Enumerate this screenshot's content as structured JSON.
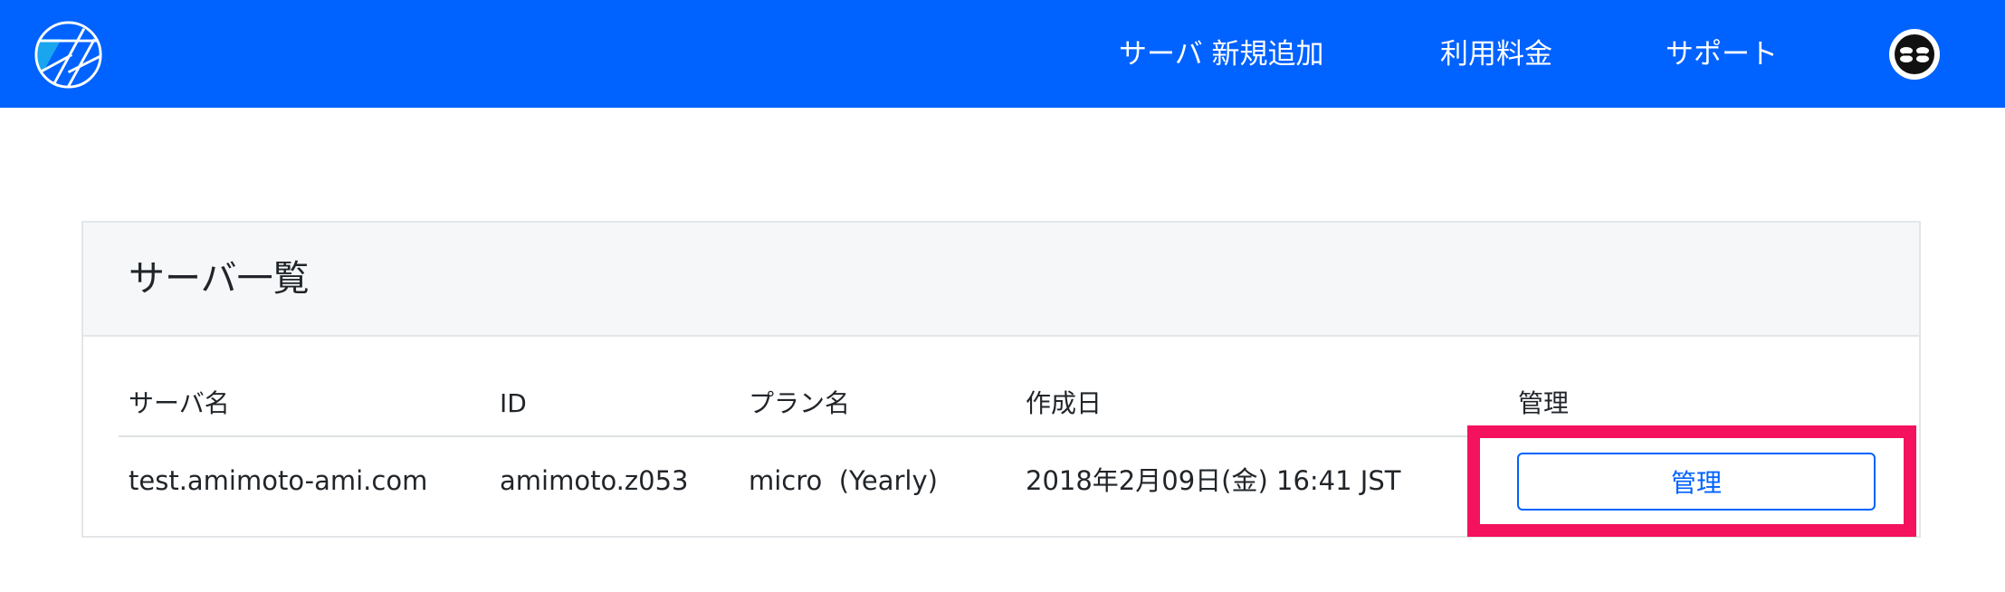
{
  "header": {
    "nav": [
      {
        "label": "サーバ 新規追加"
      },
      {
        "label": "利用料金"
      },
      {
        "label": "サポート"
      }
    ],
    "brand_color": "#0062ff"
  },
  "card": {
    "title": "サーバ一覧",
    "columns": [
      "サーバ名",
      "ID",
      "プラン名",
      "作成日",
      "管理"
    ],
    "rows": [
      {
        "server_name": "test.amimoto-ami.com",
        "id": "amimoto.z053",
        "plan": "micro  (Yearly)",
        "created": "2018年2月09日(金) 16:41 JST",
        "manage_label": "管理"
      }
    ]
  },
  "annotation": {
    "highlight_color": "#f4115e"
  }
}
